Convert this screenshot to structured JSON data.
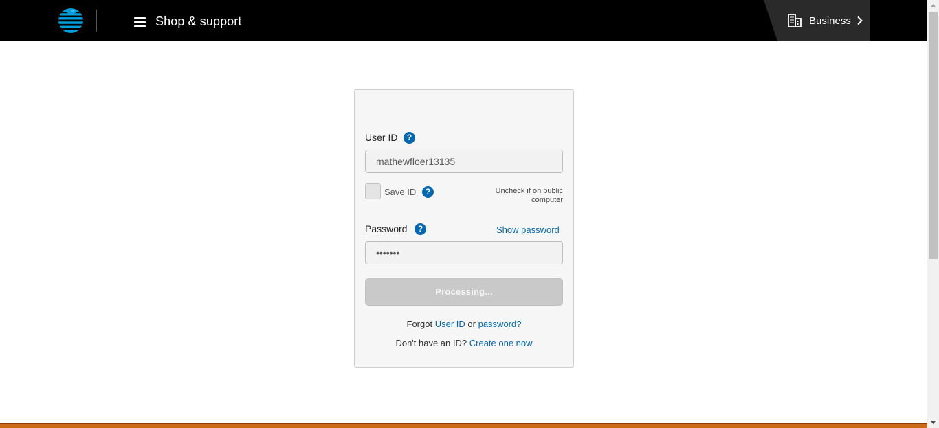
{
  "header": {
    "logo_icon": "att-globe-icon",
    "menu_icon": "hamburger-menu-icon",
    "menu_label": "Shop & support",
    "business_icon": "building-icon",
    "business_label": "Business",
    "business_chevron": "chevron-right-icon"
  },
  "login": {
    "user_id_label": "User ID",
    "user_id_value": "mathewfloer13135",
    "save_id_label": "Save ID",
    "save_id_checked": false,
    "uncheck_note_line1": "Uncheck if on public",
    "uncheck_note_line2": "computer",
    "password_label": "Password",
    "password_value": "•••••••",
    "show_password_label": "Show password",
    "submit_label": "Processing...",
    "help_glyph": "?",
    "forgot_prefix": "Forgot",
    "forgot_user_id": "User ID",
    "forgot_or": "or",
    "forgot_password": "password",
    "forgot_suffix": "?",
    "no_id_text": "Don't have an ID?",
    "create_link": "Create one now"
  },
  "colors": {
    "header_bg": "#000000",
    "link": "#0568ae",
    "help_badge": "#0568ae",
    "button_disabled": "#c9c9c9",
    "footer_accent": "#cd6b17",
    "logo_blue": "#009fdb"
  }
}
